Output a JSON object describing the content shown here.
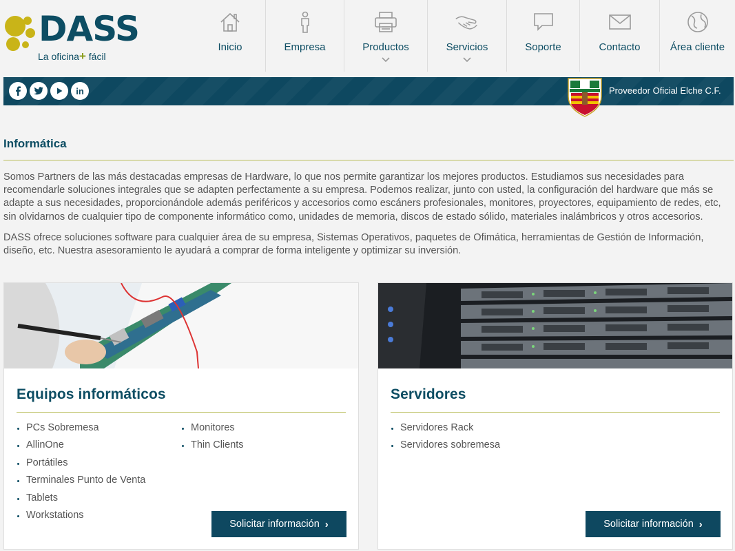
{
  "brand": {
    "name": "DASS",
    "tagline_a": "La oficina",
    "tagline_plus": "+",
    "tagline_b": " fácil",
    "colors": {
      "primary": "#0d4d63",
      "accent": "#8a9d1c",
      "dot": "#c9b418"
    }
  },
  "nav": {
    "items": [
      {
        "label": "Inicio",
        "icon": "home-icon"
      },
      {
        "label": "Empresa",
        "icon": "person-icon"
      },
      {
        "label": "Productos",
        "icon": "printer-icon",
        "has_dropdown": true
      },
      {
        "label": "Servicios",
        "icon": "handshake-icon",
        "has_dropdown": true
      },
      {
        "label": "Soporte",
        "icon": "speech-bubble-icon"
      },
      {
        "label": "Contacto",
        "icon": "envelope-icon"
      },
      {
        "label": "Área cliente",
        "icon": "globe-icon"
      }
    ]
  },
  "socialbar": {
    "networks": [
      "facebook-icon",
      "twitter-icon",
      "youtube-icon",
      "linkedin-icon"
    ],
    "linkedin_text": "in",
    "provider": "Proveedor Oficial Elche C.F."
  },
  "section": {
    "title": "Informática",
    "p1": "Somos Partners de las más destacadas empresas de Hardware, lo que nos permite garantizar los mejores productos. Estudiamos sus necesidades para recomendarle soluciones integrales que se adapten perfectamente a su empresa. Podemos realizar, junto con usted, la configuración del hardware que más se adapte a sus necesidades, proporcionándole además periféricos y accesorios como escáners profesionales, monitores, proyectores, equipamiento de redes, etc, sin olvidarnos de cualquier tipo de componente informático como, unidades de memoria, discos de estado sólido, materiales inalámbricos y otros accesorios.",
    "p2": "DASS ofrece soluciones software para cualquier área de su empresa, Sistemas Operativos, paquetes de Ofimática, herramientas de Gestión de Información, diseño, etc. Nuestra asesoramiento le ayudará a comprar de forma inteligente y optimizar su inversión."
  },
  "cards": [
    {
      "title": "Equipos informáticos",
      "col1": [
        "PCs Sobremesa",
        "AllinOne",
        "Portátiles",
        "Terminales Punto de Venta",
        "Tablets",
        "Workstations"
      ],
      "col2": [
        "Monitores",
        "Thin Clients"
      ],
      "button": "Solicitar información"
    },
    {
      "title": "Servidores",
      "col1": [
        "Servidores Rack",
        "Servidores sobremesa"
      ],
      "button": "Solicitar información"
    }
  ]
}
